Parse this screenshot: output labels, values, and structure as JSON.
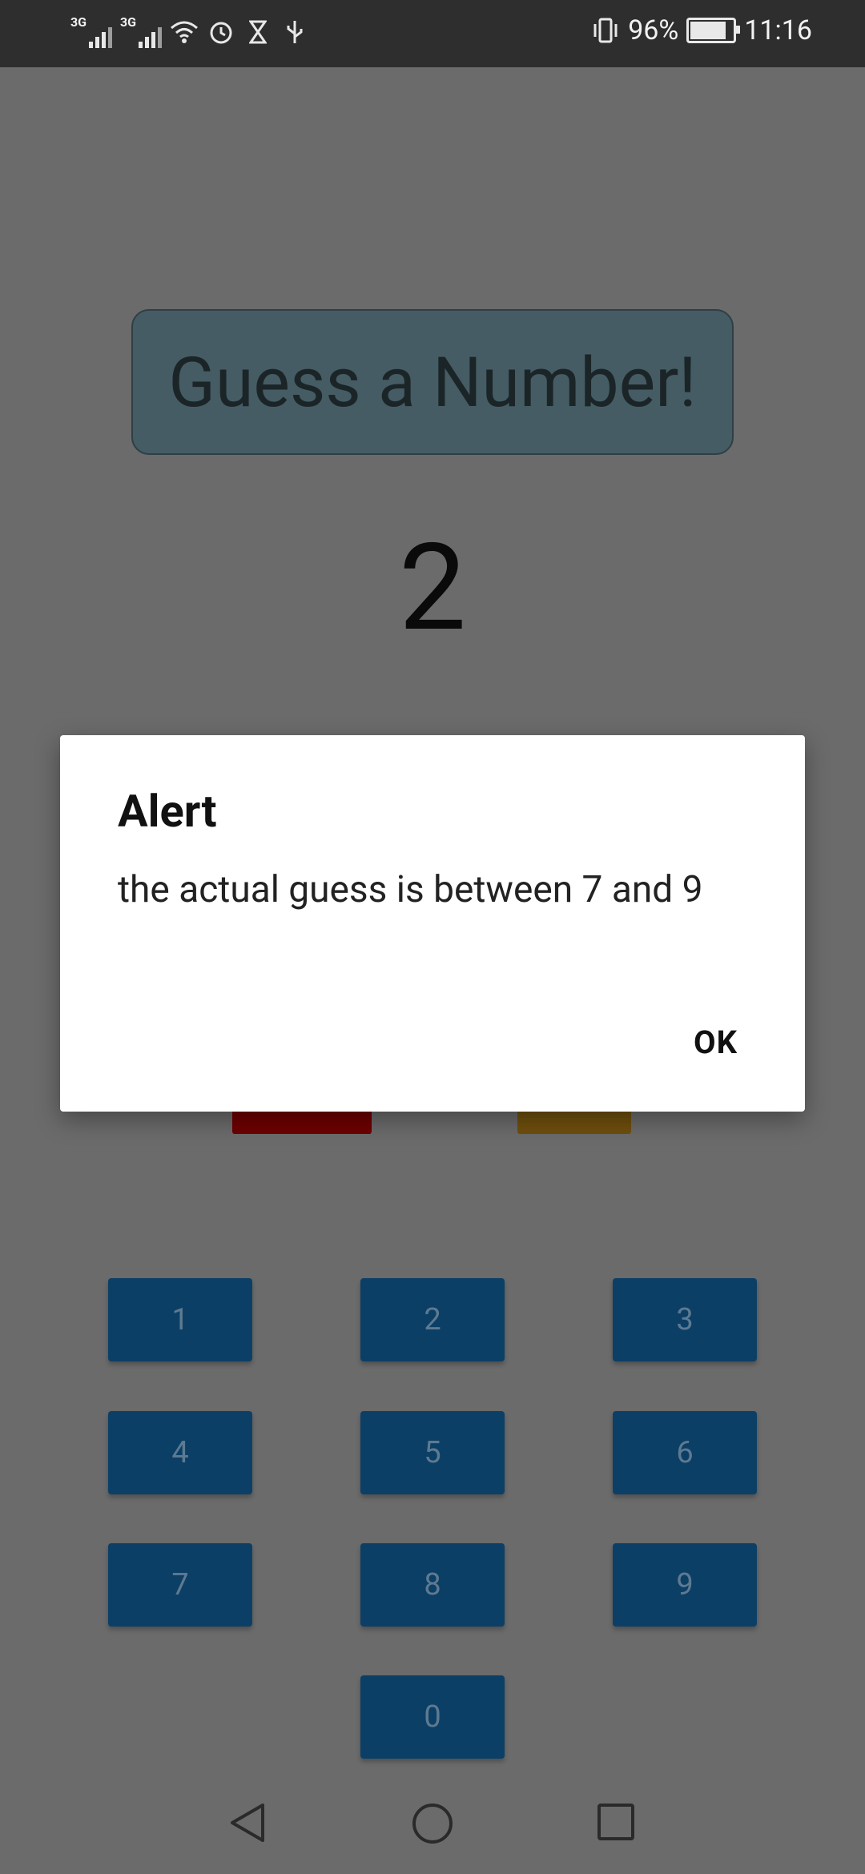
{
  "status_bar": {
    "sim1_label": "3G",
    "sim2_label": "3G",
    "battery_percent": "96%",
    "battery_level": 0.96,
    "time": "11:16",
    "icons": [
      "signal-icon",
      "signal-icon",
      "wifi-icon",
      "alarm-icon",
      "hourglass-icon",
      "usb-icon",
      "vibrate-icon",
      "battery-icon"
    ]
  },
  "app": {
    "title": "Guess a Number!",
    "current_guess": "2",
    "keypad": [
      "1",
      "2",
      "3",
      "4",
      "5",
      "6",
      "7",
      "8",
      "9",
      "0"
    ]
  },
  "dialog": {
    "title": "Alert",
    "message": "the actual guess is between 7 and 9",
    "ok_label": "OK"
  },
  "nav_bar": {
    "icons": [
      "back-icon",
      "home-icon",
      "recents-icon"
    ]
  }
}
